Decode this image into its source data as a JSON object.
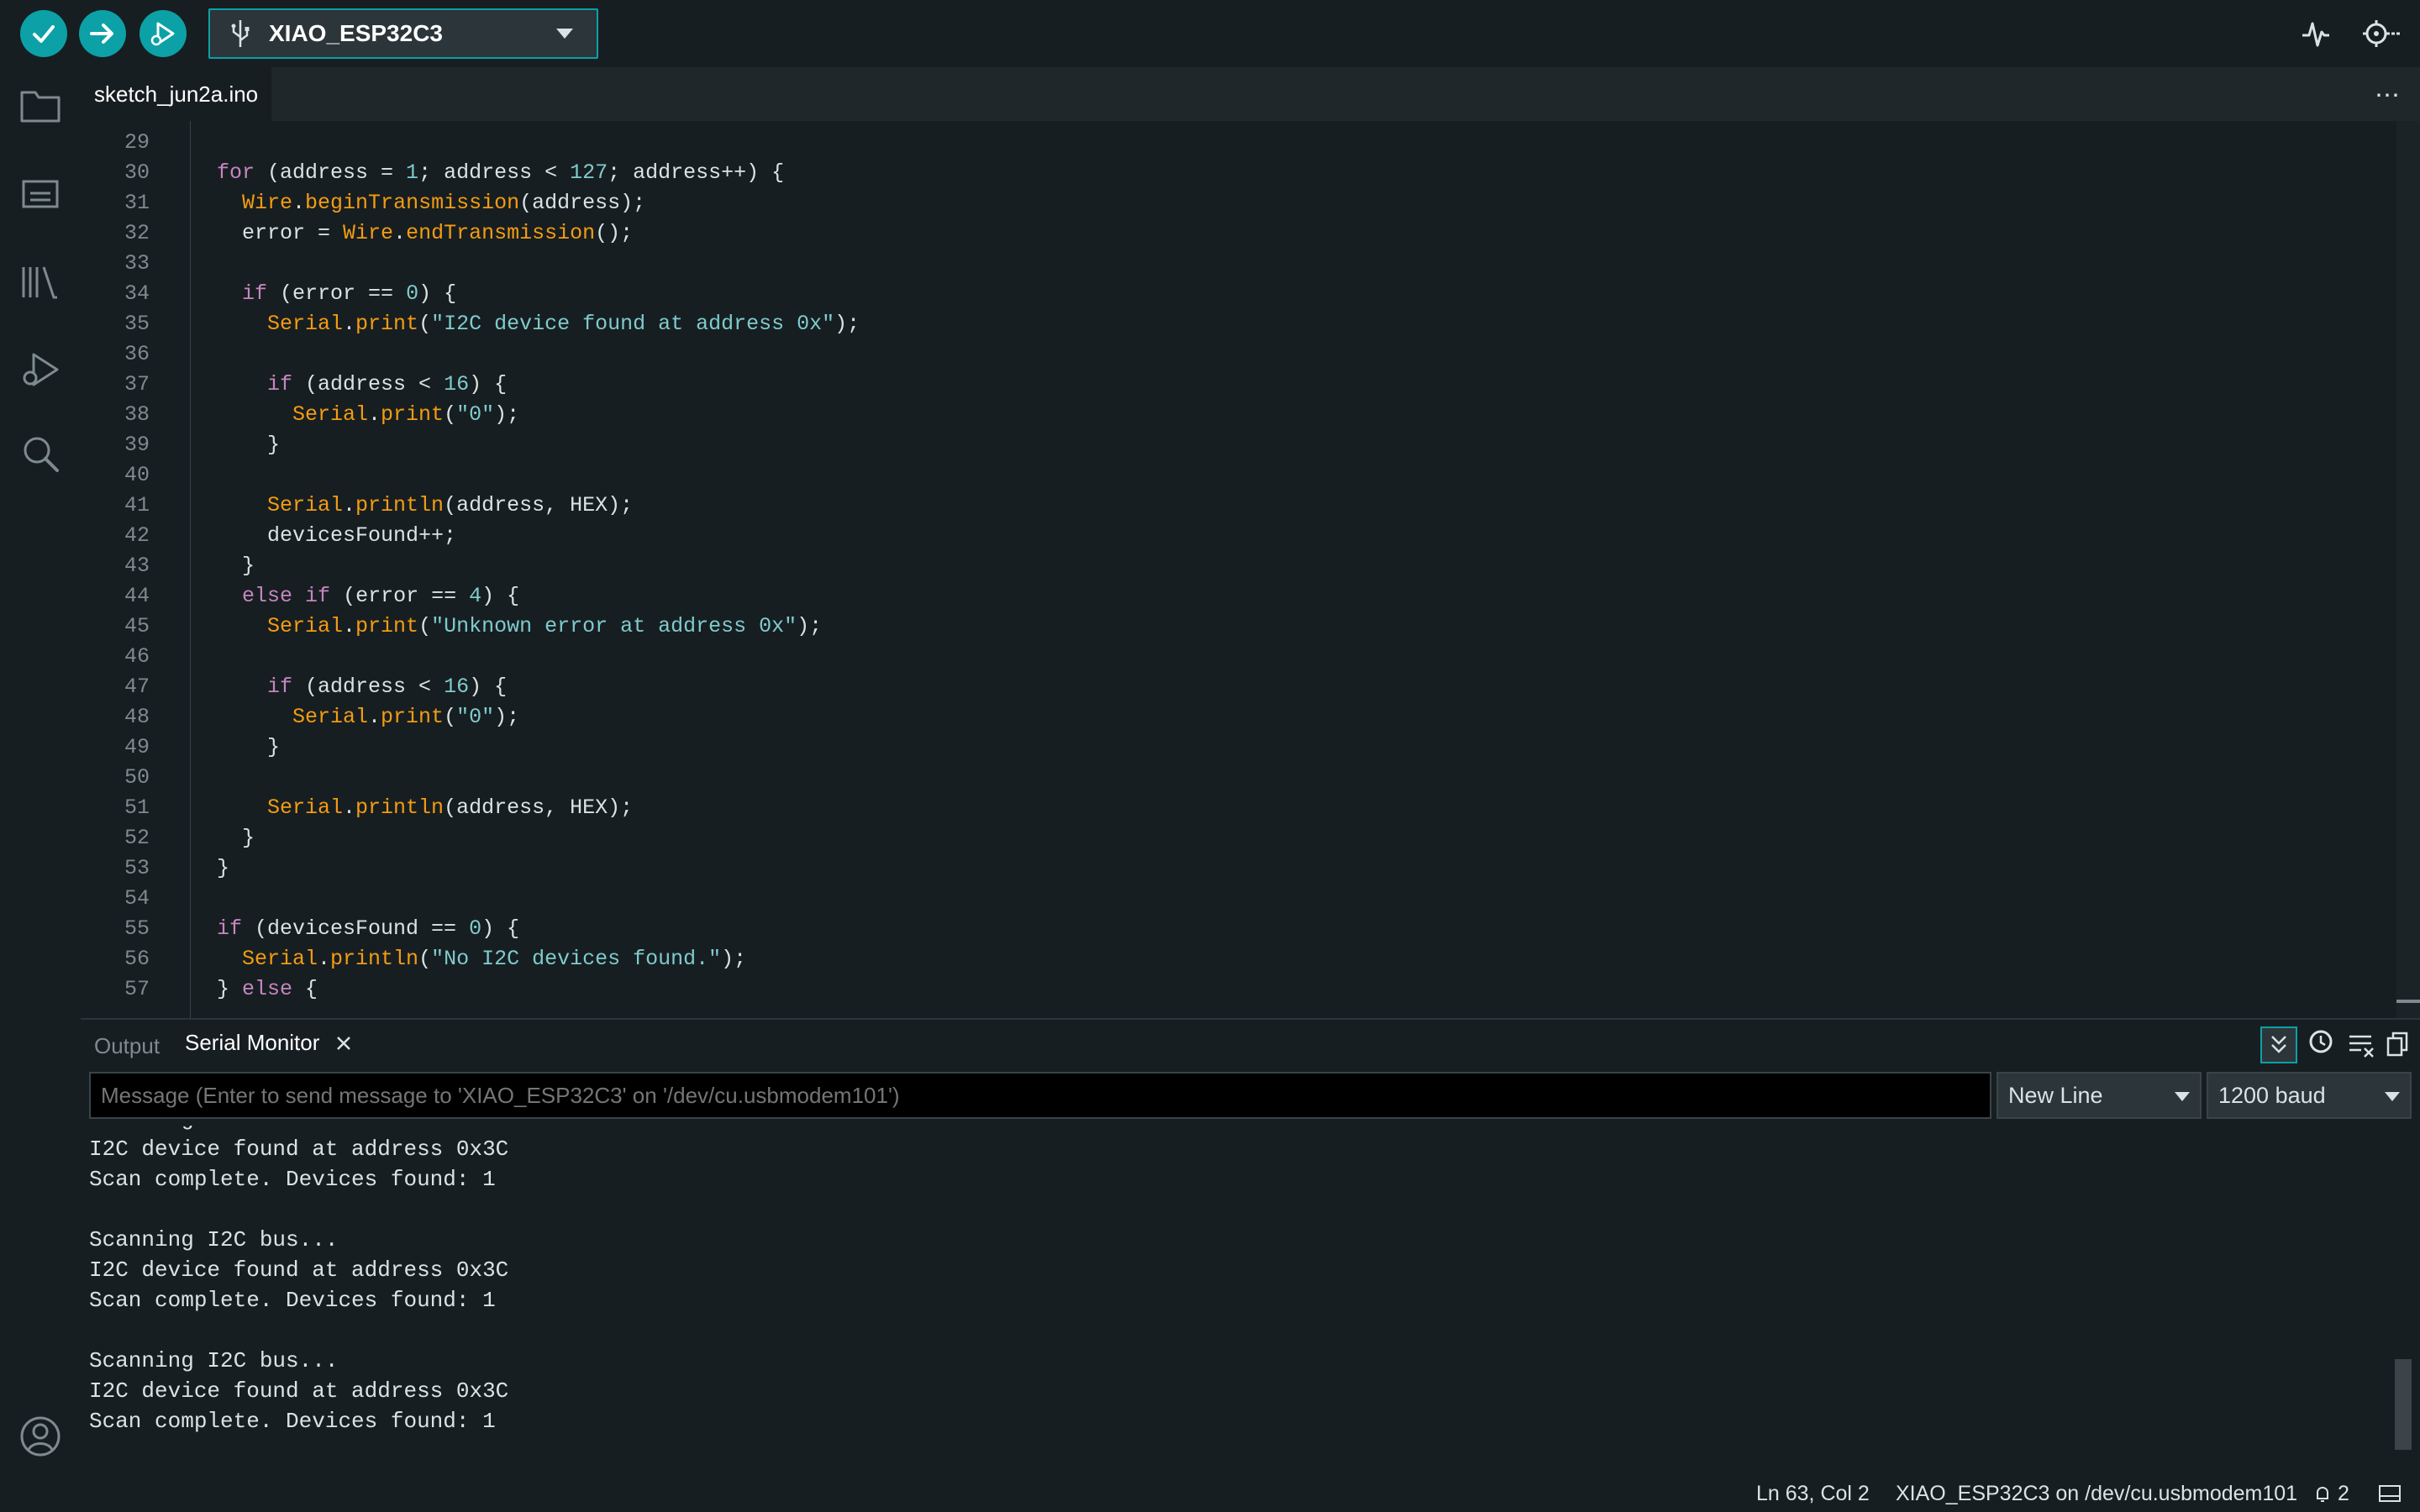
{
  "toolbar": {
    "board": "XIAO_ESP32C3",
    "verify_icon": "check-icon",
    "upload_icon": "arrow-right-icon",
    "debug_icon": "debug-icon"
  },
  "editor": {
    "tab": "sketch_jun2a.ino",
    "lines": [
      {
        "n": "29",
        "t": ""
      },
      {
        "n": "30",
        "t": "for (address = 1; address < 127; address++) {"
      },
      {
        "n": "31",
        "t": "  Wire.beginTransmission(address);"
      },
      {
        "n": "32",
        "t": "  error = Wire.endTransmission();"
      },
      {
        "n": "33",
        "t": ""
      },
      {
        "n": "34",
        "t": "  if (error == 0) {"
      },
      {
        "n": "35",
        "t": "    Serial.print(\"I2C device found at address 0x\");"
      },
      {
        "n": "36",
        "t": ""
      },
      {
        "n": "37",
        "t": "    if (address < 16) {"
      },
      {
        "n": "38",
        "t": "      Serial.print(\"0\");"
      },
      {
        "n": "39",
        "t": "    }"
      },
      {
        "n": "40",
        "t": ""
      },
      {
        "n": "41",
        "t": "    Serial.println(address, HEX);"
      },
      {
        "n": "42",
        "t": "    devicesFound++;"
      },
      {
        "n": "43",
        "t": "  }"
      },
      {
        "n": "44",
        "t": "  else if (error == 4) {"
      },
      {
        "n": "45",
        "t": "    Serial.print(\"Unknown error at address 0x\");"
      },
      {
        "n": "46",
        "t": ""
      },
      {
        "n": "47",
        "t": "    if (address < 16) {"
      },
      {
        "n": "48",
        "t": "      Serial.print(\"0\");"
      },
      {
        "n": "49",
        "t": "    }"
      },
      {
        "n": "50",
        "t": ""
      },
      {
        "n": "51",
        "t": "    Serial.println(address, HEX);"
      },
      {
        "n": "52",
        "t": "  }"
      },
      {
        "n": "53",
        "t": "}"
      },
      {
        "n": "54",
        "t": ""
      },
      {
        "n": "55",
        "t": "if (devicesFound == 0) {"
      },
      {
        "n": "56",
        "t": "  Serial.println(\"No I2C devices found.\");"
      },
      {
        "n": "57",
        "t": "} else {"
      }
    ]
  },
  "panel": {
    "tab_output": "Output",
    "tab_serial": "Serial Monitor",
    "message_placeholder": "Message (Enter to send message to 'XIAO_ESP32C3' on '/dev/cu.usbmodem101')",
    "line_ending": "New Line",
    "baud": "1200 baud",
    "output": [
      "I2C device found at address 0x3C",
      "Scan complete. Devices found: 1",
      "",
      "Scanning I2C bus...",
      "I2C device found at address 0x3C",
      "Scan complete. Devices found: 1",
      "",
      "Scanning I2C bus...",
      "I2C device found at address 0x3C",
      "Scan complete. Devices found: 1"
    ]
  },
  "status": {
    "cursor": "Ln 63, Col 2",
    "board_port": "XIAO_ESP32C3 on /dev/cu.usbmodem101",
    "notifications": "2"
  }
}
